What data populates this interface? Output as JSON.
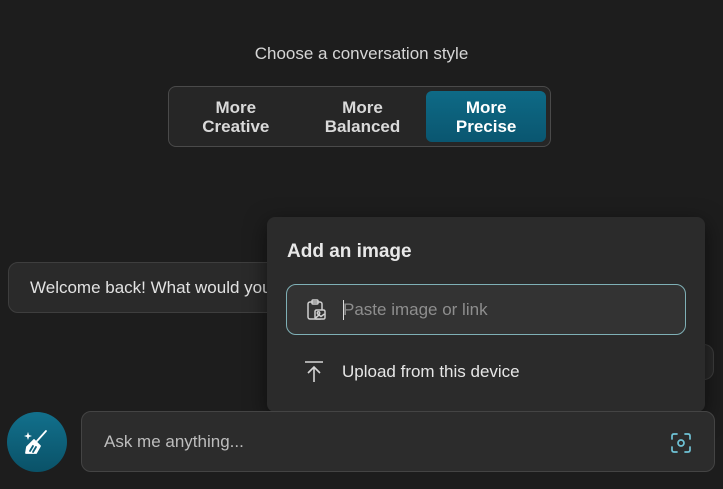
{
  "style_picker": {
    "heading": "Choose a conversation style",
    "options": [
      {
        "label": "More\nCreative",
        "selected": false
      },
      {
        "label": "More\nBalanced",
        "selected": false
      },
      {
        "label": "More\nPrecise",
        "selected": true
      }
    ]
  },
  "welcome_message": "Welcome back! What would you",
  "image_popup": {
    "title": "Add an image",
    "paste_placeholder": "Paste image or link",
    "paste_value": "",
    "upload_label": "Upload from this device",
    "icons": {
      "paste": "clipboard-image-icon",
      "upload": "upload-icon"
    }
  },
  "composer": {
    "placeholder": "Ask me anything...",
    "value": "",
    "new_topic_icon": "broom-icon",
    "image_button_icon": "visual-search-icon"
  },
  "colors": {
    "background": "#1d1d1d",
    "accent": "#0e6a86",
    "field_focus_border": "#7fb0b6"
  }
}
